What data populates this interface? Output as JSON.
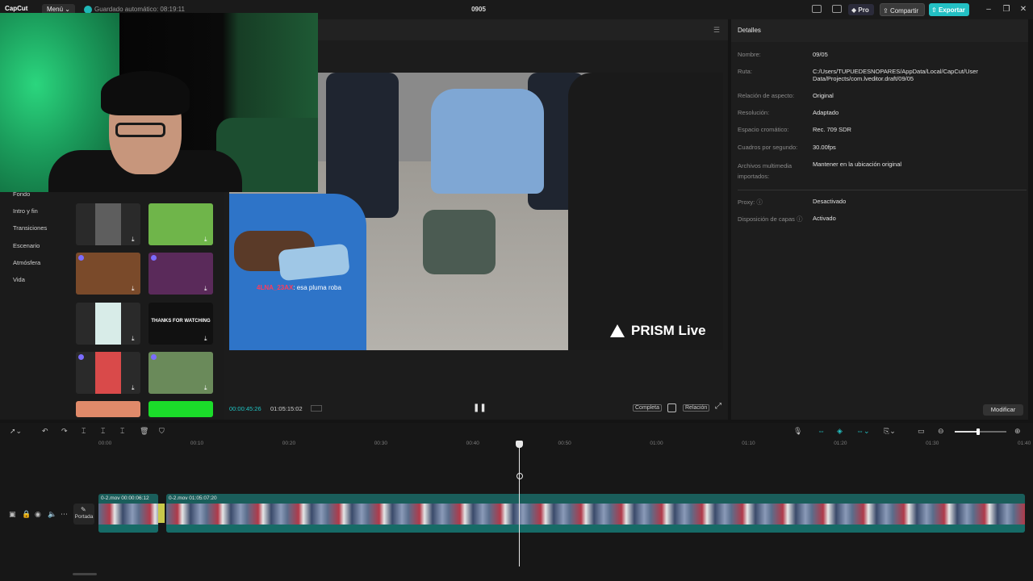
{
  "titlebar": {
    "logo": "CapCut",
    "menu": "Menú ⌄",
    "autosave": "Guardado automático: 08:19:11",
    "project": "0905",
    "pro": "Pro",
    "share": "Compartir",
    "export": "Exportar"
  },
  "left_panel": {
    "categories": [
      "Fondo",
      "Intro y fin",
      "Transiciones",
      "Escenario",
      "Atmósfera",
      "Vida"
    ],
    "thumbnails": [
      {
        "color": "#5e5e5e"
      },
      {
        "color": "#6fb54a"
      },
      {
        "color": "#7a4a2a"
      },
      {
        "color": "#5a2a5a"
      },
      {
        "color": "#d8ece8"
      },
      {
        "color": "#111111",
        "text": "THANKS FOR WATCHING"
      },
      {
        "color": "#d94a4a"
      },
      {
        "color": "#6a8a5a"
      },
      {
        "color": "#e08a6a"
      },
      {
        "color": "#1bdc2a"
      }
    ]
  },
  "player": {
    "chat_user": "4LNA_23AX",
    "chat_msg": ": esa pluma roba",
    "watermark": "PRISM Live",
    "time_current": "00:00:45:26",
    "time_total": "01:05:15:02",
    "btn_full": "Completa",
    "btn_ratio": "Relación"
  },
  "details": {
    "title": "Detalles",
    "rows": [
      {
        "label": "Nombre:",
        "value": "09/05"
      },
      {
        "label": "Ruta:",
        "value": "C:/Users/TUPUEDESNOPARES/AppData/Local/CapCut/User Data/Projects/com.lveditor.draft/09/05"
      },
      {
        "label": "Relación de aspecto:",
        "value": "Original"
      },
      {
        "label": "Resolución:",
        "value": "Adaptado"
      },
      {
        "label": "Espacio cromático:",
        "value": "Rec. 709 SDR"
      },
      {
        "label": "Cuadros por segundo:",
        "value": "30.00fps"
      },
      {
        "label": "Archivos multimedia importados:",
        "value": "Mantener en la ubicación original"
      },
      {
        "label": "Proxy: ⓘ",
        "value": "Desactivado"
      },
      {
        "label": "Disposición de capas ⓘ",
        "value": "Activado"
      }
    ],
    "modify": "Modificar"
  },
  "timeline": {
    "ruler": [
      "00:00",
      "00:10",
      "00:20",
      "00:30",
      "00:40",
      "00:50",
      "01:00",
      "01:10",
      "01:20",
      "01:30",
      "01:40"
    ],
    "cover": "Portada",
    "clip1_label": "0-2.mov  00:00:06:12",
    "clip2_label": "0-2.mov  01:05:07:20",
    "zoom_level": 0.45
  }
}
